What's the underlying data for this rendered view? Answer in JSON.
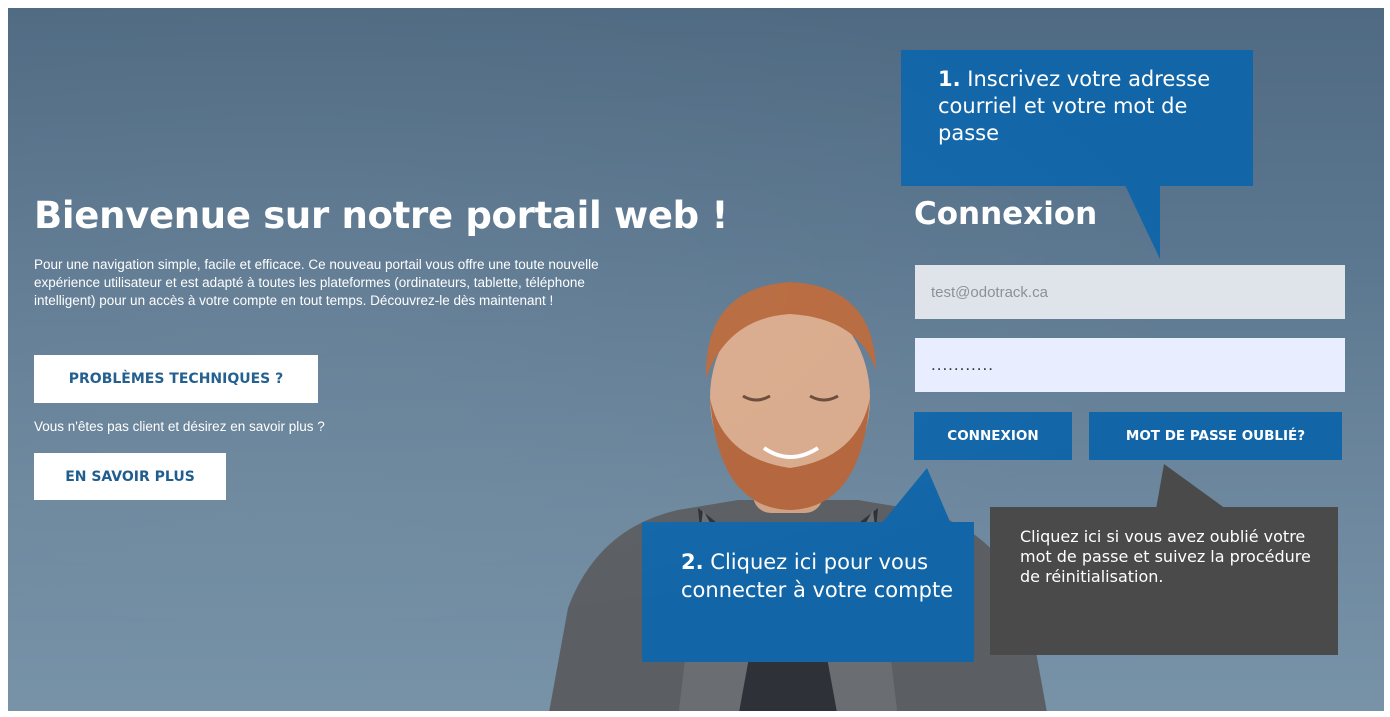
{
  "welcome": {
    "title": "Bienvenue sur notre portail web !",
    "text": "Pour une navigation simple, facile et efficace. Ce nouveau portail vous offre une toute nouvelle expérience utilisateur et est adapté à toutes les plateformes (ordinateurs, tablette, téléphone intelligent) pour un accès à votre compte en tout temps. Découvrez-le dès maintenant !",
    "tech_button": "PROBLÈMES TECHNIQUES ?",
    "not_client_text": "Vous n'êtes pas client et désirez en savoir plus ?",
    "more_button": "EN SAVOIR PLUS"
  },
  "login": {
    "title": "Connexion",
    "email_placeholder": "test@odotrack.ca",
    "email_value": "",
    "password_value": "...........",
    "connect_button": "CONNEXION",
    "forgot_button": "MOT DE PASSE OUBLIÉ?"
  },
  "callouts": {
    "step1_number": "1.",
    "step1_text": "Inscrivez votre adresse courriel et votre mot de passe",
    "step2_number": "2.",
    "step2_text": "Cliquez ici pour vous connecter à votre compte",
    "forgot_help": "Cliquez ici si vous avez oublié votre mot de passe et suivez la procédure de réinitialisation."
  },
  "colors": {
    "accent_blue": "#1266a8",
    "dark_callout": "#4a4a4a",
    "background": "#5b778f"
  }
}
